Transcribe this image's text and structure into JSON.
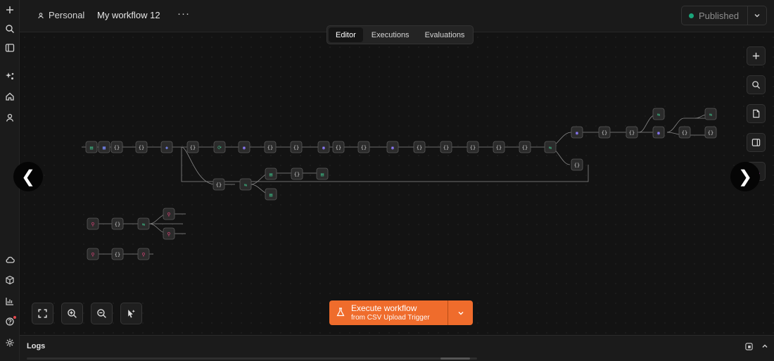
{
  "header": {
    "project": "Personal",
    "workflow_title": "My workflow 12",
    "more_label": "···",
    "status": "Published",
    "status_color": "#1aa57a"
  },
  "tabs": [
    {
      "label": "Editor",
      "active": true
    },
    {
      "label": "Executions",
      "active": false
    },
    {
      "label": "Evaluations",
      "active": false
    }
  ],
  "left_rail": {
    "top_icons": [
      "plus-icon",
      "search-icon",
      "sidebar-toggle-icon",
      "sparkle-icon",
      "home-icon",
      "user-icon"
    ],
    "bottom_icons": [
      "cloud-icon",
      "templates-icon",
      "insights-icon",
      "help-icon",
      "settings-icon"
    ]
  },
  "right_tools": [
    "add-node-icon",
    "search-nodes-icon",
    "sticky-note-icon",
    "panel-toggle-icon",
    "ai-assistant-icon"
  ],
  "bottom_tools": [
    "fit-view-icon",
    "zoom-in-icon",
    "zoom-out-icon",
    "tidy-up-icon"
  ],
  "execute": {
    "label": "Execute workflow",
    "sublabel": "from CSV Upload Trigger",
    "icon": "flask-icon",
    "color": "#ef6c2c"
  },
  "logs": {
    "title": "Logs"
  },
  "nav": {
    "prev": "❮",
    "next": "❯"
  },
  "accent_color": "#ef6c2c"
}
